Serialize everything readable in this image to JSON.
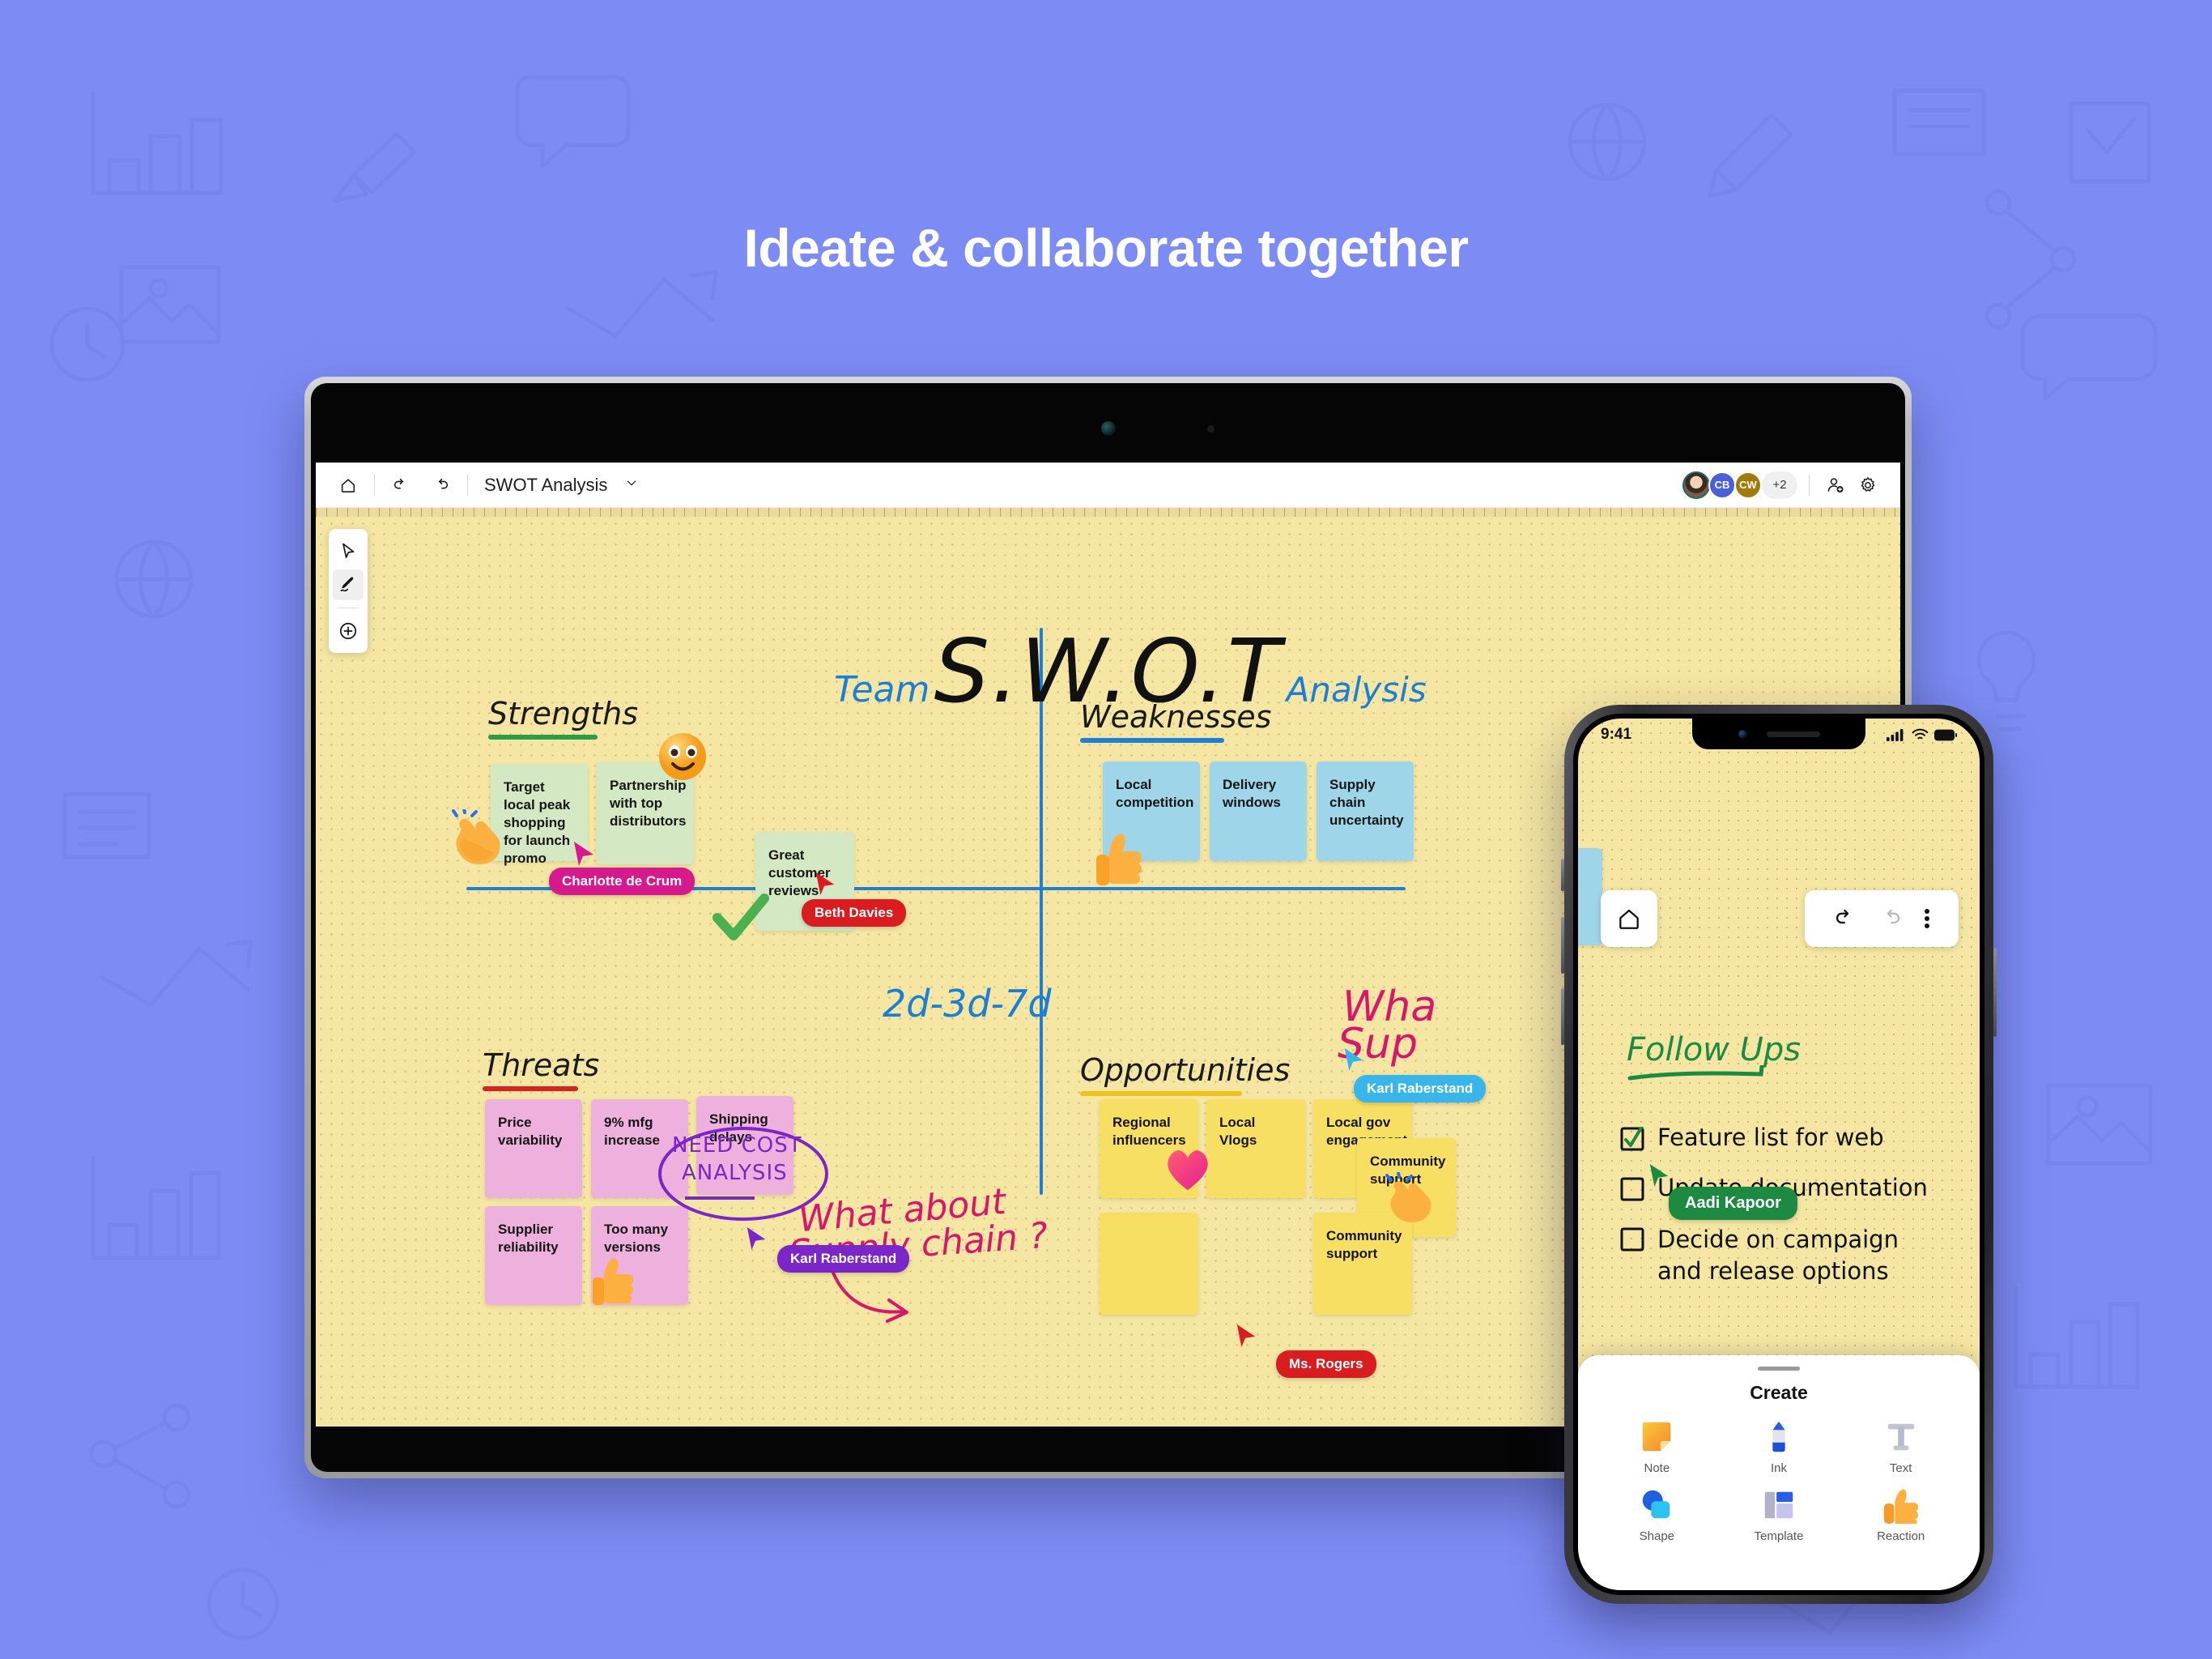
{
  "headline": "Ideate & collaborate together",
  "theme": {
    "background": "#7d8cf5",
    "canvas": "#f5e6a3",
    "accent_blue": "#1e7fd4"
  },
  "tablet": {
    "appbar": {
      "home_icon": "home-icon",
      "undo_icon": "undo-icon",
      "redo_icon": "redo-icon",
      "board_title": "SWOT Analysis",
      "chevron_icon": "chevron-down-icon",
      "share_icon": "add-person-icon",
      "settings_icon": "gear-icon",
      "collaborators": [
        {
          "initials": "",
          "type": "photo",
          "color": "#1a6b68"
        },
        {
          "initials": "CB",
          "type": "initials",
          "color": "#4b5fd6"
        },
        {
          "initials": "CW",
          "type": "initials",
          "color": "#a07a0a"
        }
      ],
      "overflow_count": "+2"
    },
    "palette": [
      {
        "name": "select-tool",
        "icon": "cursor-arrow-icon",
        "active": false
      },
      {
        "name": "pen-tool",
        "icon": "pen-icon",
        "active": true
      },
      {
        "name": "add-tool",
        "icon": "plus-circle-icon",
        "active": false
      }
    ],
    "board": {
      "title_prefix": "Team",
      "title_main": "S.W.O.T",
      "title_suffix": "Analysis",
      "quadrants": [
        {
          "label": "Strengths",
          "underline": "#2a9d45"
        },
        {
          "label": "Weaknesses",
          "underline": "#1e7fd4"
        },
        {
          "label": "Threats",
          "underline": "#d62222"
        },
        {
          "label": "Opportunities",
          "underline": "#f2c218"
        }
      ],
      "strengths_notes": [
        "Target local peak shopping for launch promo",
        "Partnership with top distributors",
        "Great customer reviews"
      ],
      "weaknesses_notes": [
        "Local competition",
        "Delivery windows",
        "Supply chain uncertainty"
      ],
      "threats_notes": [
        "Price variability",
        "9% mfg increase",
        "Shipping delays",
        "Supplier reliability",
        "Too many versions"
      ],
      "opportunities_notes": [
        "Regional influencers",
        "Local Vlogs",
        "Local gov engagement",
        "Community support",
        "Community support"
      ],
      "ink_annotations": [
        {
          "text": "2d-3d-7d",
          "color": "#1b7fd6"
        },
        {
          "text": "NEED COST",
          "color": "#7b26c9"
        },
        {
          "text": "ANALYSIS",
          "color": "#7b26c9"
        },
        {
          "text": "What about",
          "color": "#d6176a"
        },
        {
          "text": "Supply chain ?",
          "color": "#d6176a"
        },
        {
          "text": "Wha",
          "color": "#d6176a"
        },
        {
          "text": "Sup",
          "color": "#d6176a"
        }
      ],
      "cursors": [
        {
          "name": "Charlotte de Crum",
          "color": "#d6198c"
        },
        {
          "name": "Beth Davies",
          "color": "#d81c20"
        },
        {
          "name": "Karl Raberstand",
          "color": "#7b26c9"
        },
        {
          "name": "Karl Raberstand",
          "color": "#38b6ec"
        },
        {
          "name": "Ms. Rogers",
          "color": "#d81c20"
        }
      ],
      "reactions": [
        {
          "name": "clap-emoji",
          "glyph": "clap"
        },
        {
          "name": "smile-emoji",
          "glyph": "smile"
        },
        {
          "name": "thumbs-up-emoji",
          "glyph": "thumb"
        },
        {
          "name": "check-mark",
          "glyph": "check"
        },
        {
          "name": "heart-emoji",
          "glyph": "heart"
        }
      ]
    }
  },
  "phone": {
    "status": {
      "time": "9:41",
      "signal_icon": "cellular-icon",
      "wifi_icon": "wifi-icon",
      "battery_icon": "battery-icon"
    },
    "home_icon": "home-icon",
    "undo_icon": "undo-icon",
    "redo_icon": "redo-icon",
    "more_icon": "more-vertical-icon",
    "followups": {
      "title": "Follow Ups",
      "items": [
        {
          "text": "Feature list for web",
          "checked": true
        },
        {
          "text": "Update  documentation",
          "checked": false
        },
        {
          "text": "Decide on campaign and release options",
          "checked": false
        }
      ],
      "cursor": {
        "name": "Aadi Kapoor",
        "color": "#1d8a42"
      }
    },
    "sheet": {
      "title": "Create",
      "items": [
        {
          "label": "Note",
          "icon": "sticky-note-icon"
        },
        {
          "label": "Ink",
          "icon": "pen-icon"
        },
        {
          "label": "Text",
          "icon": "text-icon"
        },
        {
          "label": "Shape",
          "icon": "shape-icon"
        },
        {
          "label": "Template",
          "icon": "template-icon"
        },
        {
          "label": "Reaction",
          "icon": "thumbs-up-icon"
        }
      ]
    }
  }
}
